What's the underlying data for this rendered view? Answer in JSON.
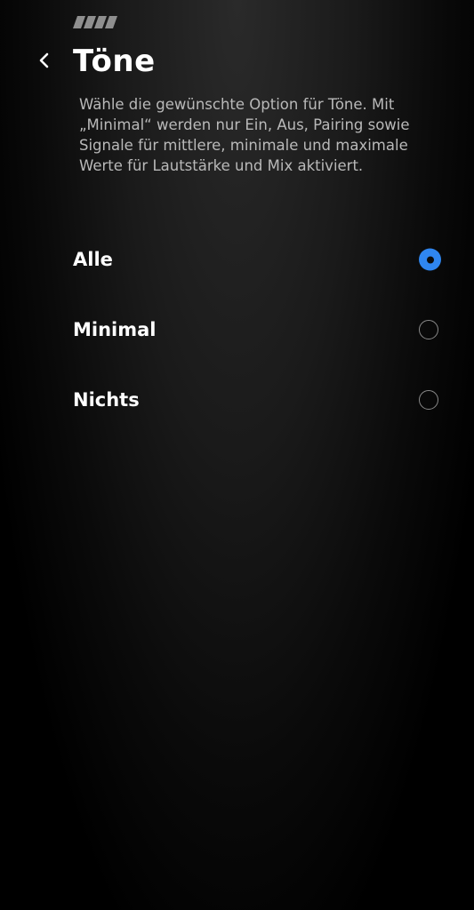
{
  "header": {
    "title": "Töne",
    "back_icon": "chevron-left-icon",
    "brand_icon": "stripes-logo-icon"
  },
  "description": "Wähle die gewünschte Option für Töne. Mit „Minimal“ werden nur Ein, Aus, Pairing sowie Signale für mittlere, minimale und maximale Werte für Lautstärke und Mix aktiviert.",
  "options": [
    {
      "label": "Alle",
      "selected": true
    },
    {
      "label": "Minimal",
      "selected": false
    },
    {
      "label": "Nichts",
      "selected": false
    }
  ],
  "colors": {
    "accent": "#2f86f0",
    "background": "#000000",
    "text": "#ffffff",
    "muted_text": "#b9b9b9"
  }
}
